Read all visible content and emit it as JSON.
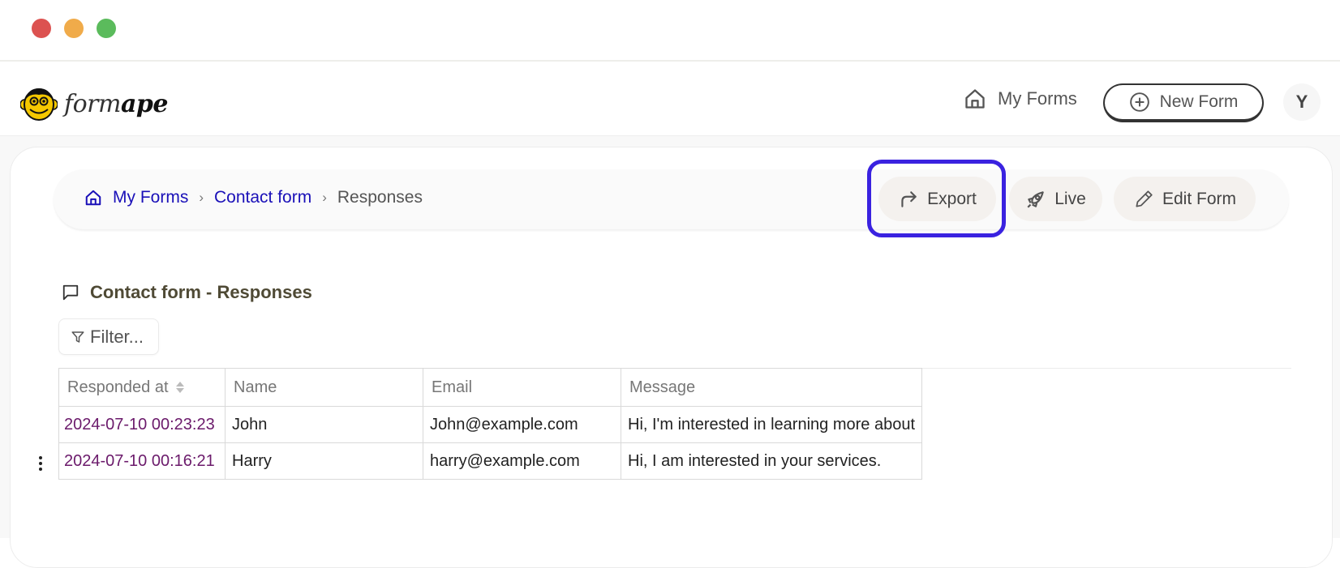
{
  "window": {
    "traffic_lights": [
      {
        "name": "close",
        "color": "#dc5250"
      },
      {
        "name": "minimize",
        "color": "#f0ab4a"
      },
      {
        "name": "maximize",
        "color": "#5bbb5c"
      }
    ]
  },
  "header": {
    "logo": {
      "icon": "monkey-face-icon",
      "text_light": "form",
      "text_bold": "ape"
    },
    "nav": {
      "my_forms_label": "My Forms",
      "my_forms_icon": "home-icon",
      "new_form_label": "New Form",
      "new_form_icon": "plus-circle-icon"
    },
    "avatar_initial": "Y"
  },
  "breadcrumb": {
    "icon": "home-icon",
    "items": [
      {
        "label": "My Forms",
        "link": true
      },
      {
        "label": "Contact form",
        "link": true
      },
      {
        "label": "Responses",
        "link": false
      }
    ],
    "separator": "›",
    "link_color": "#1a10b8"
  },
  "actions": {
    "export": {
      "label": "Export",
      "icon": "share-arrow-icon",
      "highlighted": true
    },
    "live": {
      "label": "Live",
      "icon": "rocket-icon"
    },
    "edit": {
      "label": "Edit Form",
      "icon": "pencil-icon"
    },
    "highlight_color": "#3a22e0"
  },
  "section": {
    "title": "Contact form - Responses",
    "icon": "chat-bubble-icon"
  },
  "filter": {
    "label": "Filter...",
    "icon": "filter-icon"
  },
  "table": {
    "columns": [
      {
        "label": "Responded at",
        "sortable": true
      },
      {
        "label": "Name"
      },
      {
        "label": "Email"
      },
      {
        "label": "Message"
      }
    ],
    "rows": [
      {
        "responded_at": "2024-07-10 00:23:23",
        "name": "John",
        "email": "John@example.com",
        "message": "Hi, I'm interested in learning more about"
      },
      {
        "responded_at": "2024-07-10 00:16:21",
        "name": "Harry",
        "email": "harry@example.com",
        "message": "Hi, I am interested in your services."
      }
    ]
  }
}
